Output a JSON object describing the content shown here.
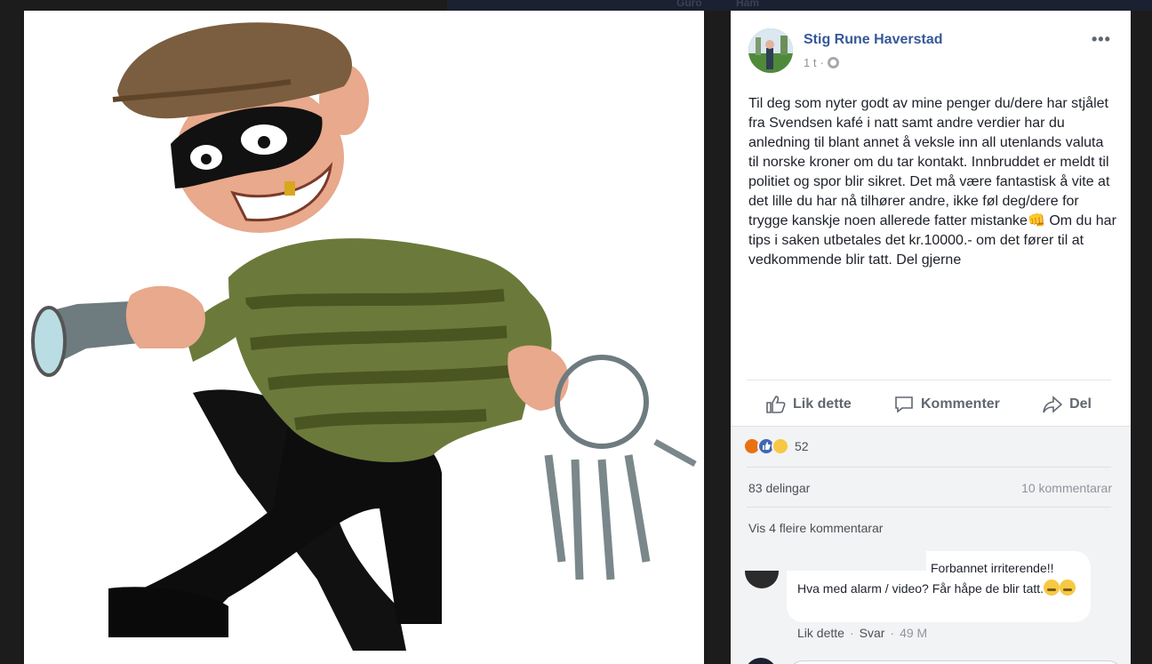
{
  "topbar": {
    "ghost_left": "Guro",
    "ghost_right": "Ham"
  },
  "post": {
    "author": "Stig Rune Haverstad",
    "time": "1 t",
    "meta_sep": "·",
    "more": "•••",
    "text_before_emoji": "Til deg som nyter godt av mine penger du/dere har stjålet fra Svendsen kafé i natt samt andre verdier har du anledning til blant annet å veksle inn all utenlands valuta til norske kroner om du tar kontakt. Innbruddet er meldt til politiet og spor blir sikret. Det må være fantastisk å vite at det lille du har nå tilhører andre, ikke føl deg/dere for trygge kanskje noen allerede fatter mistanke",
    "emoji": "👊",
    "text_after_emoji": " Om du har tips i saken utbetales det kr.10000.- om det fører til at vedkommende blir tatt. Del gjerne"
  },
  "actions": {
    "like": "Lik dette",
    "comment": "Kommenter",
    "share": "Del"
  },
  "stats": {
    "reaction_count": "52",
    "shares": "83 delingar",
    "comments": "10 kommentarar"
  },
  "comments": {
    "more": "Vis 4 fleire kommentarar",
    "first": {
      "line1": "Forbannet irriterende!!",
      "line2": "Hva med alarm / video? Får håpe de blir tatt.",
      "like": "Lik dette",
      "reply": "Svar",
      "time": "49 M"
    }
  },
  "colors": {
    "link_blue": "#365899",
    "text": "#1d2129",
    "muted": "#90949c",
    "panel_gray": "#f2f3f5"
  },
  "icons": [
    "like-icon",
    "comment-icon",
    "share-icon",
    "globe-icon",
    "more-icon",
    "angry-reaction-icon",
    "like-reaction-icon",
    "sad-reaction-icon"
  ]
}
